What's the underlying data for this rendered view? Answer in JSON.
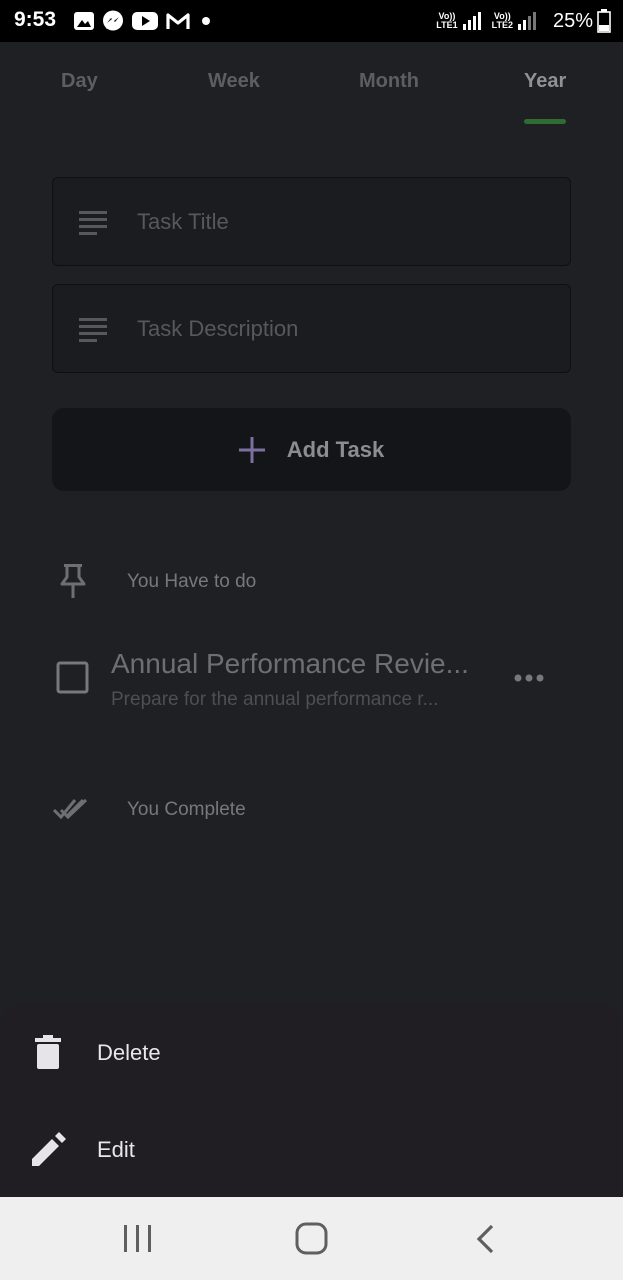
{
  "status_bar": {
    "time": "9:53",
    "sim1": "Vo)) LTE1",
    "sim2": "Vo)) LTE2",
    "battery": "25%",
    "notification_icons": [
      "image-icon",
      "messenger-icon",
      "youtube-icon",
      "gmail-icon",
      "dot-icon"
    ]
  },
  "tabs": [
    {
      "label": "Day"
    },
    {
      "label": "Week"
    },
    {
      "label": "Month"
    },
    {
      "label": "Year",
      "active": true
    }
  ],
  "form": {
    "title_placeholder": "Task Title",
    "description_placeholder": "Task Description",
    "add_button": "Add Task"
  },
  "todo_section": {
    "label": "You Have to do",
    "icon": "pin-icon"
  },
  "task": {
    "title": "Annual Performance Revie...",
    "description": "Prepare for the annual performance r...",
    "checked": false
  },
  "complete_section": {
    "label": "You Complete",
    "icon": "double-check-icon"
  },
  "bottom_sheet": {
    "items": [
      {
        "label": "Delete",
        "icon": "trash-icon"
      },
      {
        "label": "Edit",
        "icon": "pencil-icon"
      }
    ]
  },
  "colors": {
    "background": "#1e2024",
    "accent_indicator": "#2f6b33",
    "plus_icon": "#7d6fa0",
    "sheet": "#201e23"
  }
}
